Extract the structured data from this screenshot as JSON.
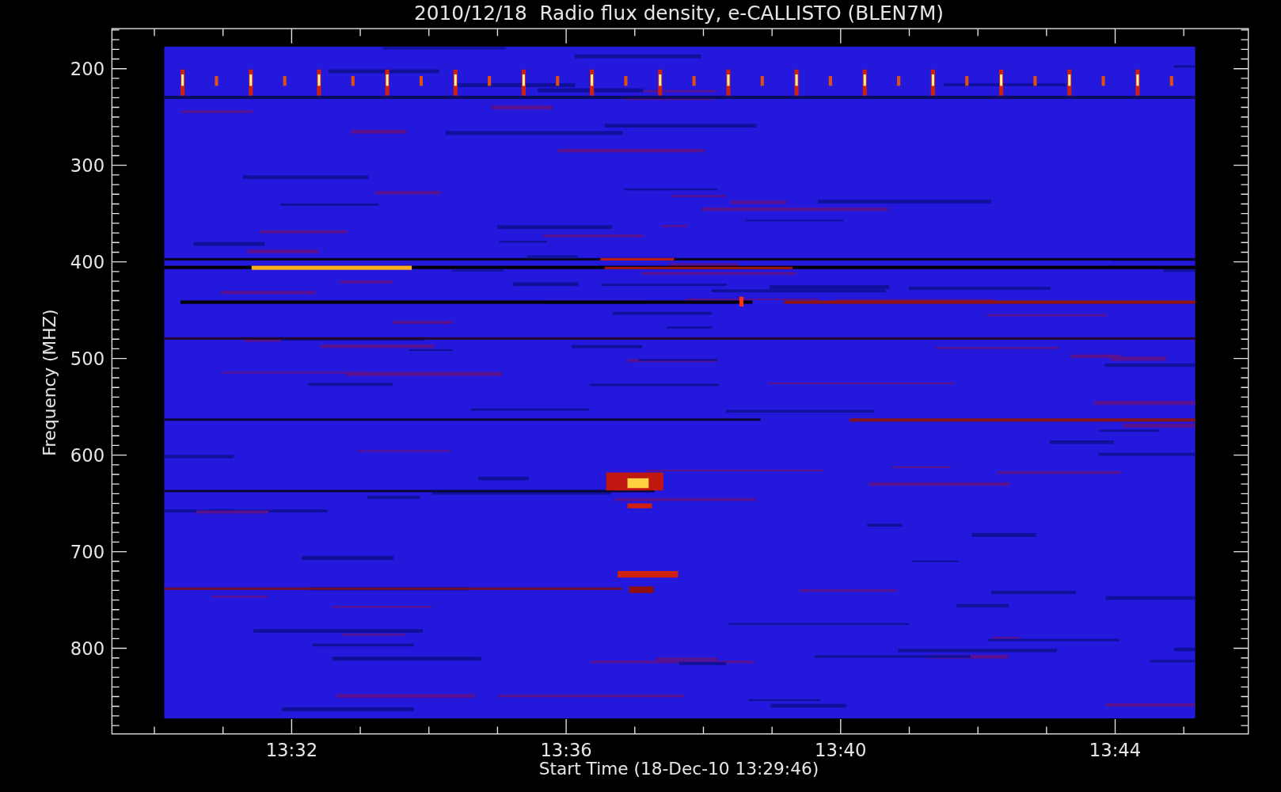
{
  "title": "2010/12/18  Radio flux density, e-CALLISTO (BLEN7M)",
  "y_axis": {
    "label": "Frequency (MHZ)",
    "ticks": [
      "200",
      "300",
      "400",
      "500",
      "600",
      "700",
      "800"
    ]
  },
  "x_axis": {
    "label": "Start Time (18-Dec-10 13:29:46)",
    "ticks": [
      "13:32",
      "13:36",
      "13:40",
      "13:44"
    ]
  }
}
